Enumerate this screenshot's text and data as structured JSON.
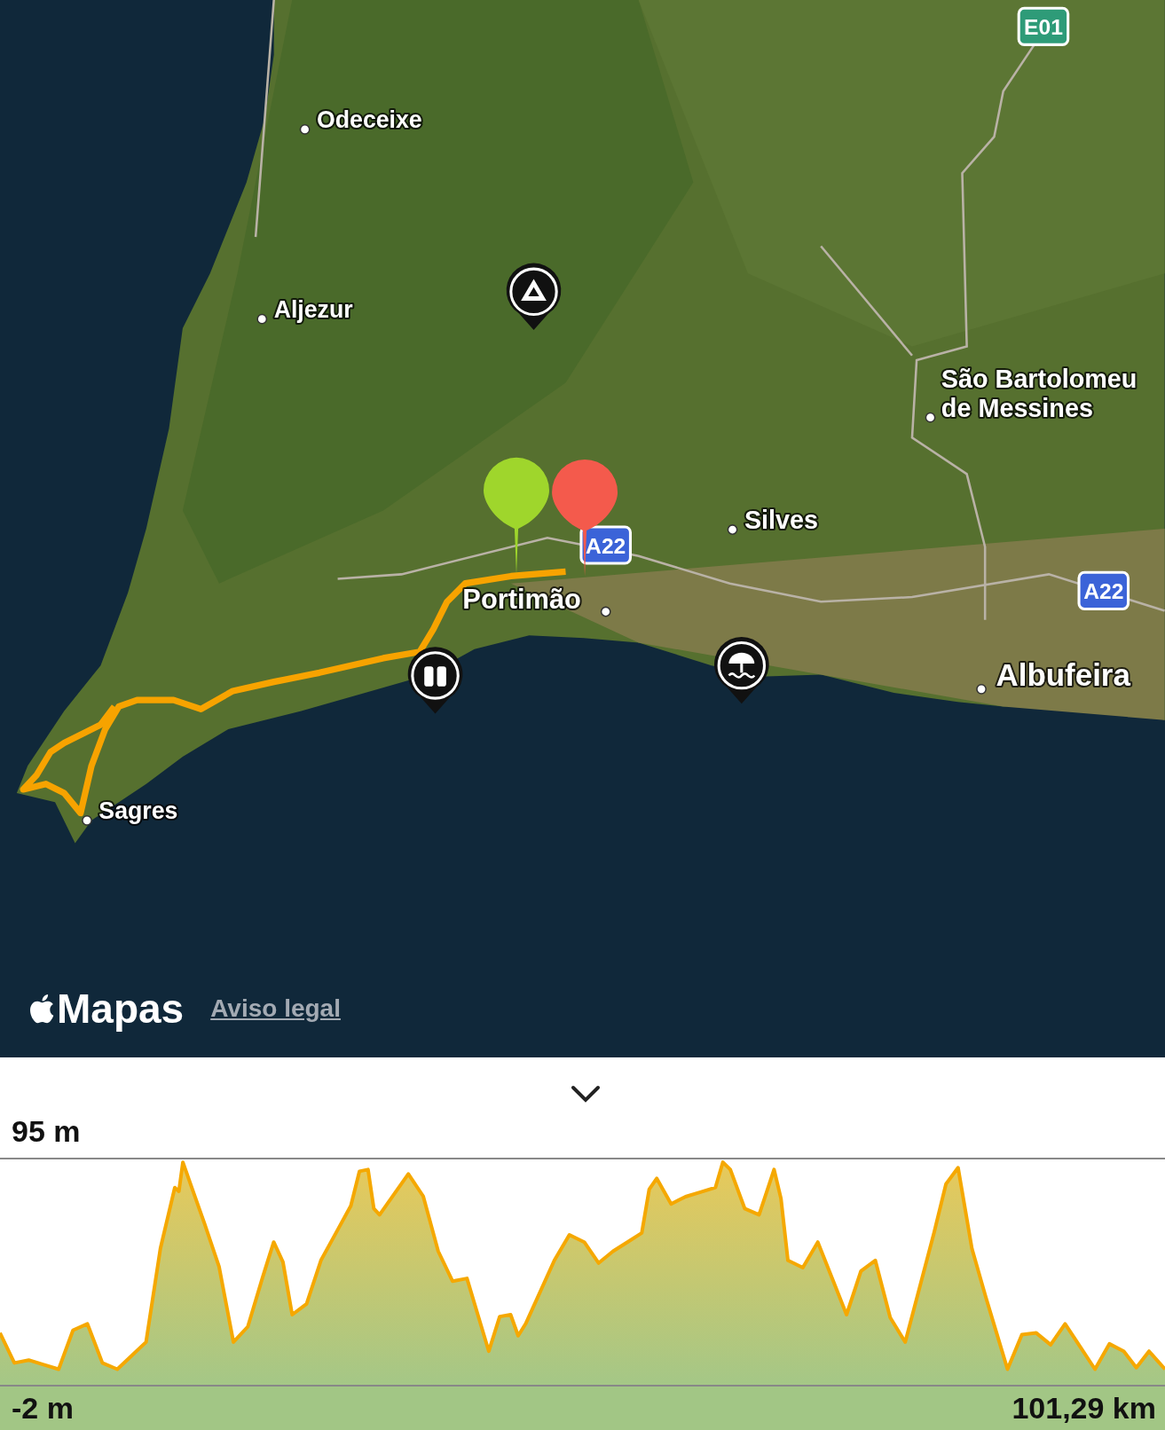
{
  "map": {
    "places": [
      {
        "name": "Odeceixe"
      },
      {
        "name": "Aljezur"
      },
      {
        "name": "São Bartolomeu de Messines"
      },
      {
        "name": "Silves"
      },
      {
        "name": "Portimão"
      },
      {
        "name": "Albufeira"
      },
      {
        "name": "Sagres"
      }
    ],
    "road_shields": [
      {
        "label": "E01"
      },
      {
        "label": "A22"
      },
      {
        "label": "A22"
      }
    ],
    "markers": [
      {
        "kind": "mountain"
      },
      {
        "kind": "viewpoint"
      },
      {
        "kind": "beach"
      }
    ],
    "route_pins": [
      {
        "color": "#9fd62c"
      },
      {
        "color": "#f45a4c"
      }
    ],
    "attribution": {
      "brand": "Mapas",
      "link": "Aviso legal"
    }
  },
  "elevation": {
    "max_label": "95 m",
    "min_label": "-2 m",
    "distance_label": "101,29 km"
  }
}
